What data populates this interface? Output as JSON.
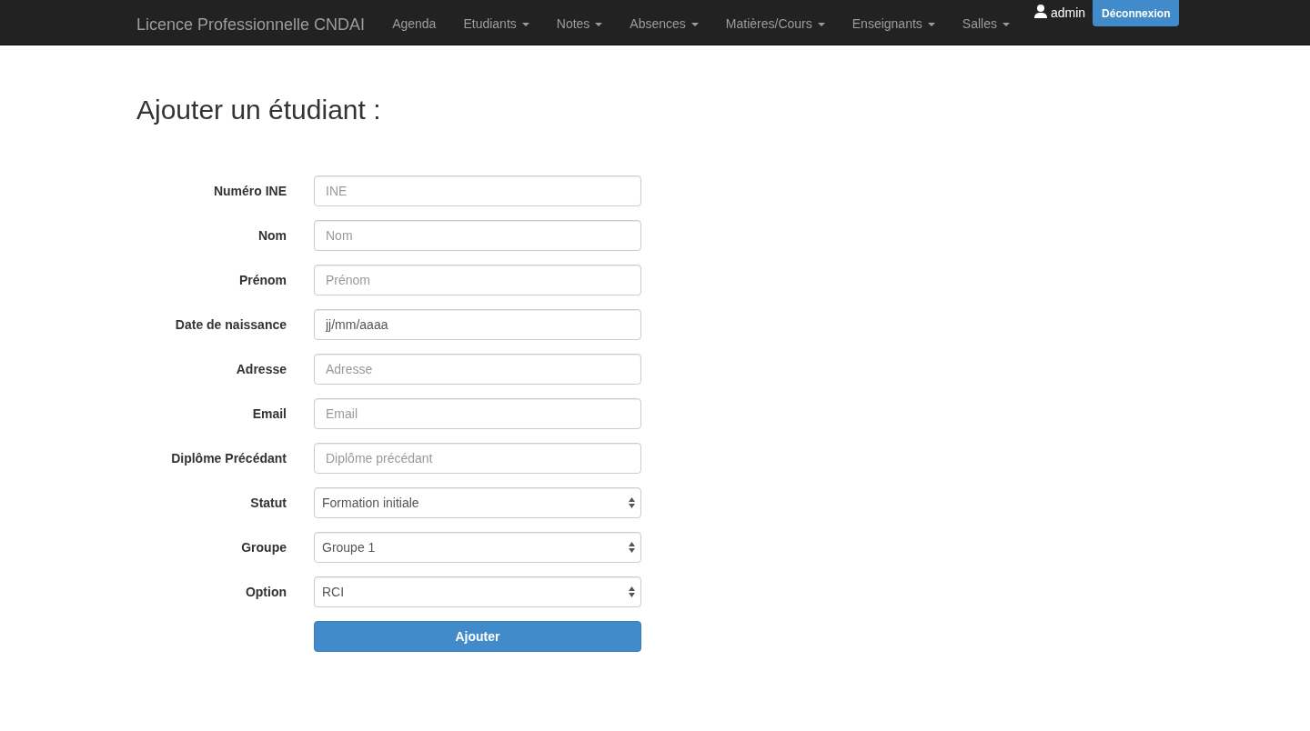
{
  "navbar": {
    "brand": "Licence Professionnelle CNDAI",
    "items": [
      {
        "label": "Agenda",
        "dropdown": false
      },
      {
        "label": "Etudiants",
        "dropdown": true
      },
      {
        "label": "Notes",
        "dropdown": true
      },
      {
        "label": "Absences",
        "dropdown": true
      },
      {
        "label": "Matières/Cours",
        "dropdown": true
      },
      {
        "label": "Enseignants",
        "dropdown": true
      },
      {
        "label": "Salles",
        "dropdown": true
      }
    ],
    "user": "admin",
    "logout_button": "Déconnexion"
  },
  "page_title": "Ajouter un étudiant :",
  "form": {
    "fields": [
      {
        "label": "Numéro INE",
        "kind": "text",
        "placeholder": "INE"
      },
      {
        "label": "Nom",
        "kind": "text",
        "placeholder": "Nom"
      },
      {
        "label": "Prénom",
        "kind": "text",
        "placeholder": "Prénom"
      },
      {
        "label": "Date de naissance",
        "kind": "text",
        "value": "jj/mm/aaaa"
      },
      {
        "label": "Adresse",
        "kind": "text",
        "placeholder": "Adresse"
      },
      {
        "label": "Email",
        "kind": "text",
        "placeholder": "Email"
      },
      {
        "label": "Diplôme Précédant",
        "kind": "text",
        "placeholder": "Diplôme précédant"
      },
      {
        "label": "Statut",
        "kind": "select",
        "value": "Formation initiale"
      },
      {
        "label": "Groupe",
        "kind": "select",
        "value": "Groupe 1"
      },
      {
        "label": "Option",
        "kind": "select",
        "value": "RCI"
      }
    ],
    "submit_button": "Ajouter"
  }
}
